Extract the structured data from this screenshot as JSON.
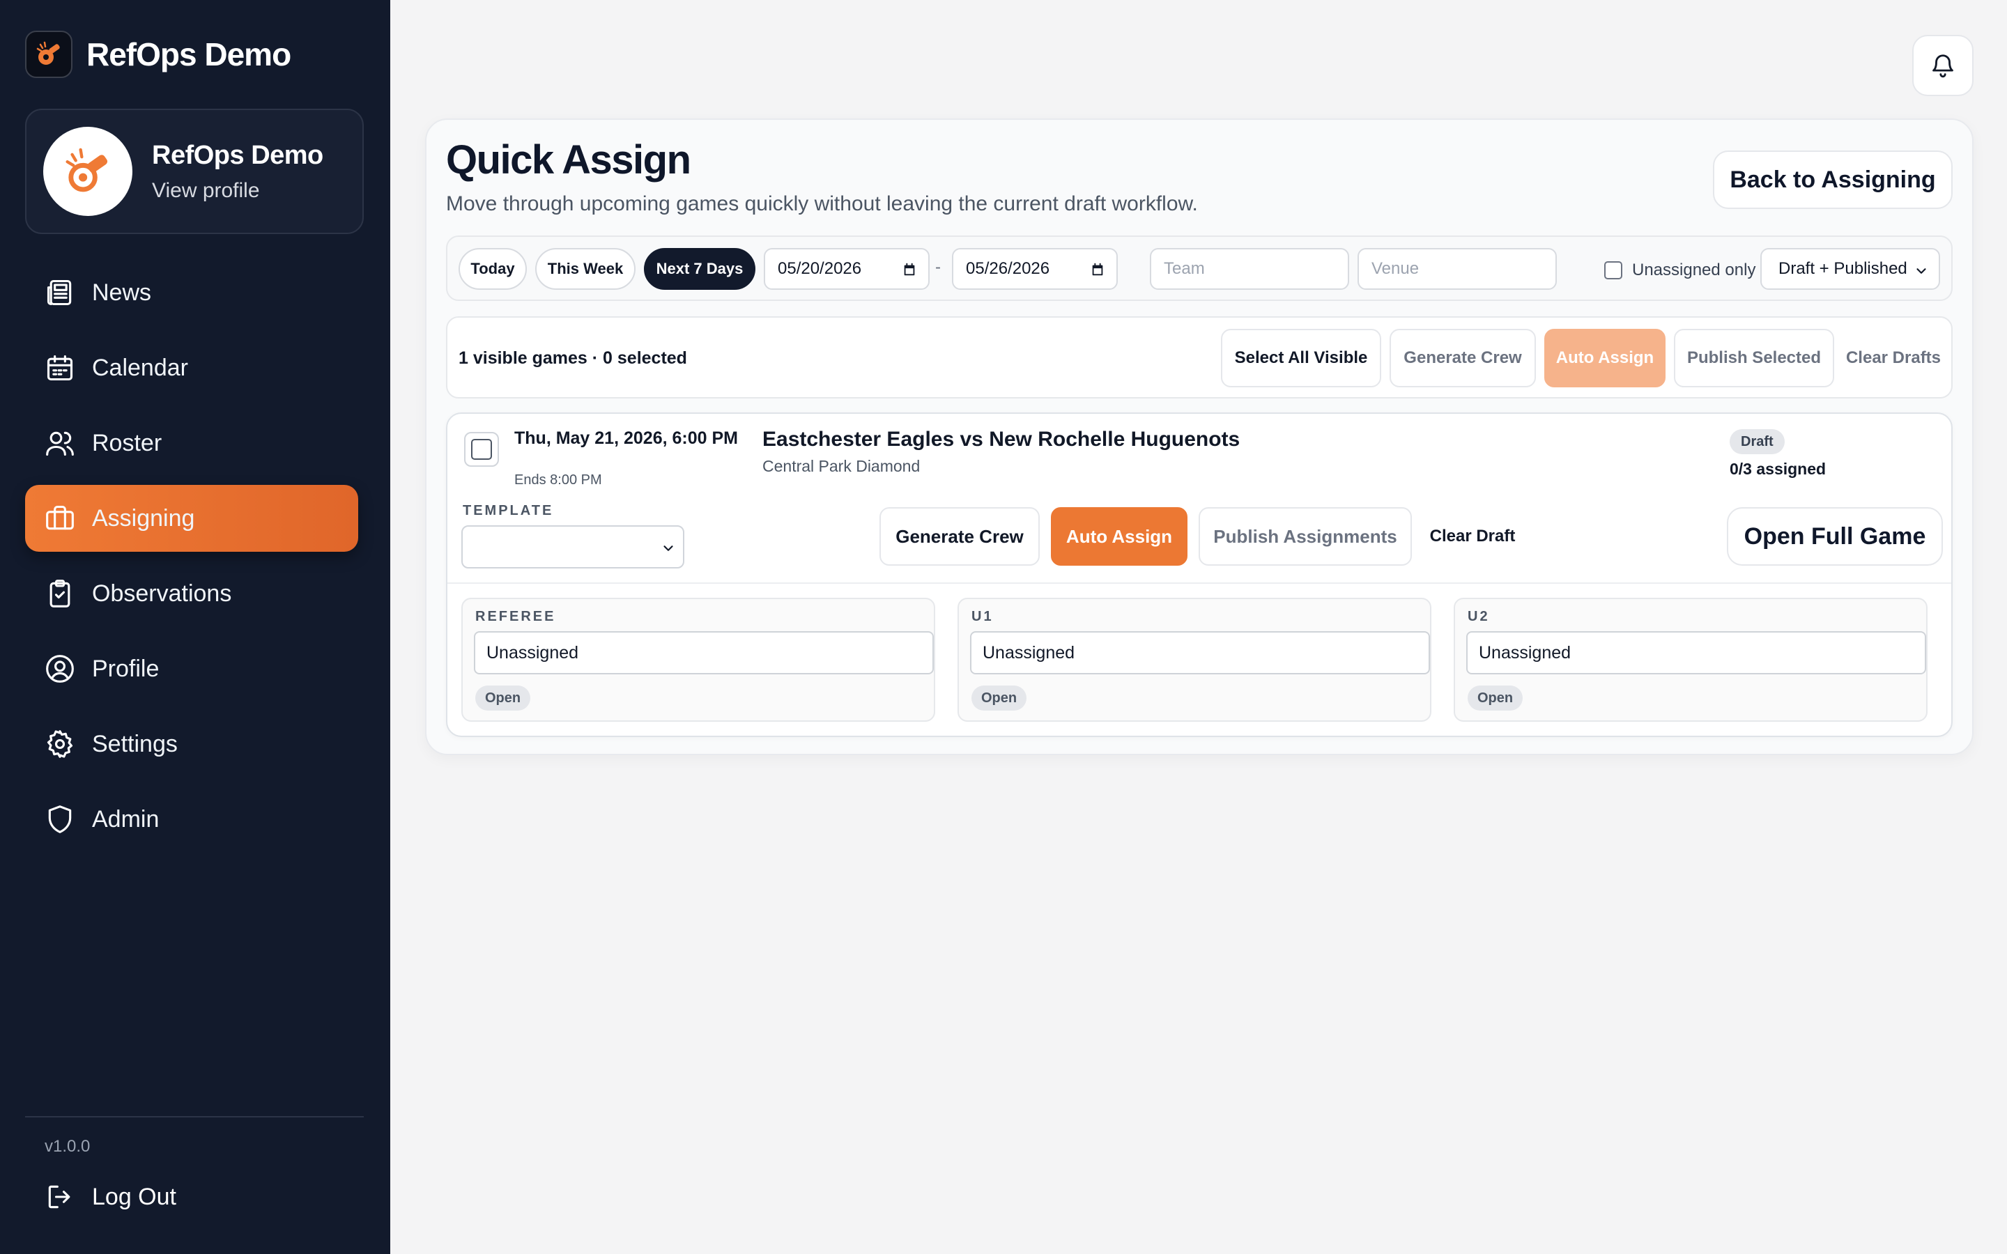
{
  "sidebar": {
    "brand": "RefOps Demo",
    "profile_name": "RefOps Demo",
    "profile_link": "View profile",
    "items": [
      {
        "label": "News",
        "icon": "newspaper-icon"
      },
      {
        "label": "Calendar",
        "icon": "calendar-icon"
      },
      {
        "label": "Roster",
        "icon": "users-icon"
      },
      {
        "label": "Assigning",
        "icon": "briefcase-icon",
        "active": true
      },
      {
        "label": "Observations",
        "icon": "clipboard-check-icon"
      },
      {
        "label": "Profile",
        "icon": "user-circle-icon"
      },
      {
        "label": "Settings",
        "icon": "gear-icon"
      },
      {
        "label": "Admin",
        "icon": "shield-icon"
      }
    ],
    "version": "v1.0.0",
    "logout": "Log Out"
  },
  "header": {
    "title": "Quick Assign",
    "subtitle": "Move through upcoming games quickly without leaving the current draft workflow.",
    "back_button": "Back to Assigning"
  },
  "filters": {
    "today": "Today",
    "this_week": "This Week",
    "next_7_days": "Next 7 Days",
    "date_from": "05/20/2026",
    "date_sep": "-",
    "date_to": "05/26/2026",
    "team_placeholder": "Team",
    "venue_placeholder": "Venue",
    "unassigned_only": "Unassigned only",
    "status_select": "Draft + Published"
  },
  "toolbar": {
    "counts": "1 visible games · 0 selected",
    "select_all": "Select All Visible",
    "generate_crew": "Generate Crew",
    "auto_assign": "Auto Assign",
    "publish_selected": "Publish Selected",
    "clear_drafts": "Clear Drafts"
  },
  "game": {
    "datetime": "Thu, May 21, 2026, 6:00 PM",
    "ends": "Ends 8:00 PM",
    "title": "Eastchester Eagles vs New Rochelle Huguenots",
    "venue": "Central Park Diamond",
    "status": "Draft",
    "assigned": "0/3 assigned",
    "template_label": "TEMPLATE",
    "generate_crew": "Generate Crew",
    "auto_assign": "Auto Assign",
    "publish_assignments": "Publish Assignments",
    "clear_draft": "Clear Draft",
    "open_full_game": "Open Full Game",
    "slots": [
      {
        "label": "REFEREE",
        "value": "Unassigned",
        "status": "Open"
      },
      {
        "label": "U1",
        "value": "Unassigned",
        "status": "Open"
      },
      {
        "label": "U2",
        "value": "Unassigned",
        "status": "Open"
      }
    ]
  },
  "colors": {
    "accent": "#ec7833",
    "sidebar_bg": "#121a2c"
  }
}
